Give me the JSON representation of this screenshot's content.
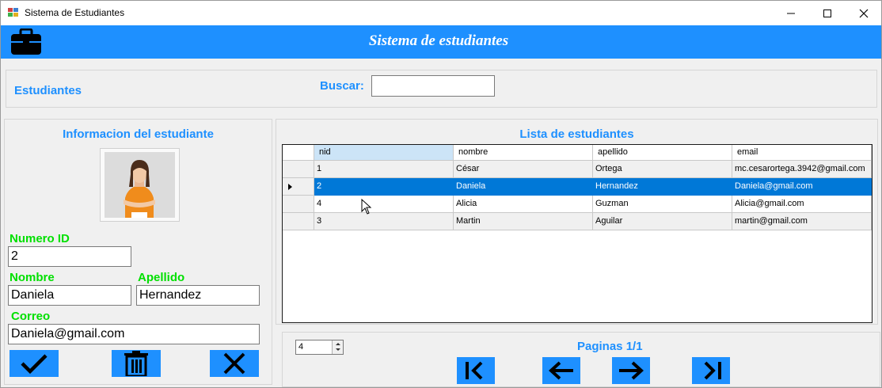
{
  "window": {
    "title": "Sistema de Estudiantes",
    "icons": [
      "app-icon",
      "minimize-icon",
      "maximize-icon",
      "close-icon"
    ]
  },
  "header": {
    "title": "Sistema de estudiantes",
    "icon": "briefcase-icon",
    "color": "#1e90ff"
  },
  "toolbar": {
    "section_label": "Estudiantes",
    "search_label": "Buscar:",
    "search_value": ""
  },
  "form": {
    "title": "Informacion del estudiante",
    "id_label": "Numero ID",
    "id_value": "2",
    "nombre_label": "Nombre",
    "nombre_value": "Daniela",
    "apellido_label": "Apellido",
    "apellido_value": "Hernandez",
    "correo_label": "Correo",
    "correo_value": "Daniela@gmail.com",
    "label_color": "#00e000",
    "buttons": [
      "check-icon",
      "trash-icon",
      "x-icon"
    ]
  },
  "list": {
    "title": "Lista de estudiantes",
    "columns": [
      "nid",
      "nombre",
      "apellido",
      "email"
    ],
    "rows": [
      [
        "1",
        "César",
        "Ortega",
        "mc.cesarortega.3942@gmail.com"
      ],
      [
        "2",
        "Daniela",
        "Hernandez",
        "Daniela@gmail.com"
      ],
      [
        "4",
        "Alicia",
        "Guzman",
        "Alicia@gmail.com"
      ],
      [
        "3",
        "Martin",
        "Aguilar",
        "martin@gmail.com"
      ]
    ],
    "selected_row": 1,
    "selection_color": "#0078d7"
  },
  "pagination": {
    "page_size": "4",
    "label": "Paginas 1/1",
    "buttons": [
      "first-page-icon",
      "prev-page-icon",
      "next-page-icon",
      "last-page-icon"
    ]
  }
}
